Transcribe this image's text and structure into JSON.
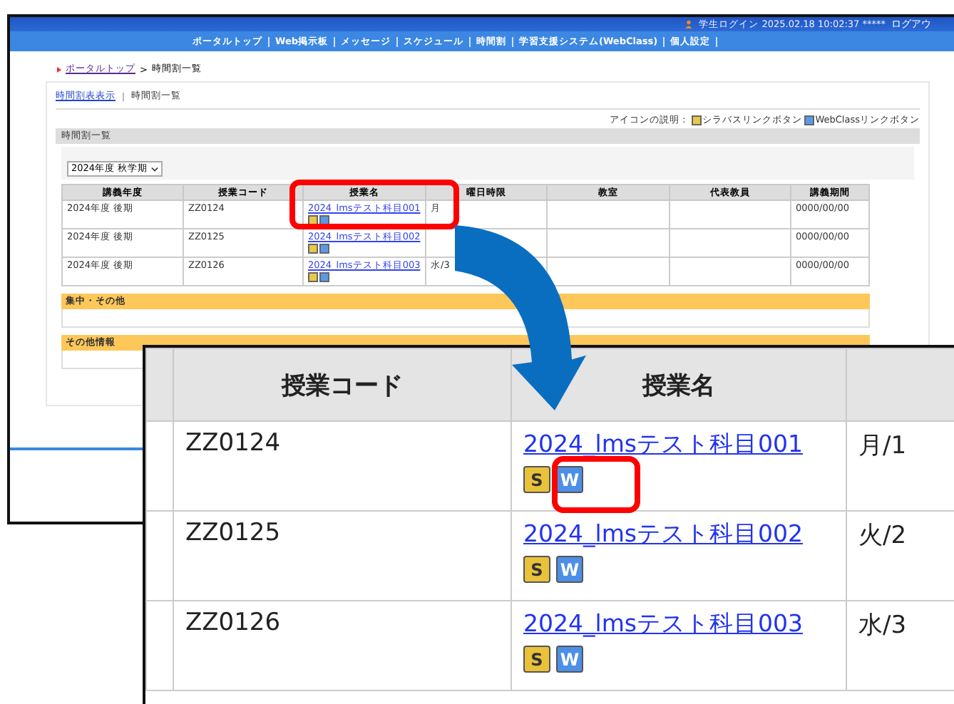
{
  "header": {
    "user_info": "学生ログイン 2025.02.18 10:02:37  *****",
    "logout": "ログアウ"
  },
  "nav": [
    "ポータルトップ",
    "Web掲示板",
    "メッセージ",
    "スケジュール",
    "時間割",
    "学習支援システム(WebClass)",
    "個人設定"
  ],
  "breadcrumb": {
    "home": "ポータルトップ",
    "separator": ">",
    "current": "時間割一覧"
  },
  "sub_tabs": [
    {
      "label": "時間割表表示",
      "selected": false
    },
    {
      "label": "時間割一覧",
      "selected": true
    }
  ],
  "legend": {
    "label": "アイコンの説明：",
    "syllabus": "シラバスリンクボタン",
    "webclass": "WebClassリンクボタン"
  },
  "panel": {
    "title": "時間割一覧",
    "term_select": "2024年度 秋学期",
    "columns": [
      "講義年度",
      "授業コード",
      "授業名",
      "曜日時限",
      "教室",
      "代表教員",
      "講義期間"
    ],
    "rows": [
      {
        "year": "2024年度 後期",
        "code": "ZZ0124",
        "course": "2024_lmsテスト科目001",
        "day": "月",
        "period": "0000/00/00"
      },
      {
        "year": "2024年度 後期",
        "code": "ZZ0125",
        "course": "2024_lmsテスト科目002",
        "period": "0000/00/00"
      },
      {
        "year": "2024年度 後期",
        "code": "ZZ0126",
        "course": "2024_lmsテスト科目003",
        "day": "水/3",
        "period": "0000/00/00"
      }
    ]
  },
  "sections": [
    {
      "title": "集中・その他"
    },
    {
      "title": "その他情報"
    }
  ],
  "zoom": {
    "columns": [
      "授業コード",
      "授業名"
    ],
    "rows": [
      {
        "code": "ZZ0124",
        "course": "2024_lmsテスト科目001",
        "syllabus_icon": "S",
        "webclass_icon": "W",
        "day": "月/1"
      },
      {
        "code": "ZZ0125",
        "course": "2024_lmsテスト科目002",
        "syllabus_icon": "S",
        "webclass_icon": "W",
        "day": "火/2"
      },
      {
        "code": "ZZ0126",
        "course": "2024_lmsテスト科目003",
        "syllabus_icon": "S",
        "webclass_icon": "W",
        "day": "水/3"
      }
    ]
  }
}
